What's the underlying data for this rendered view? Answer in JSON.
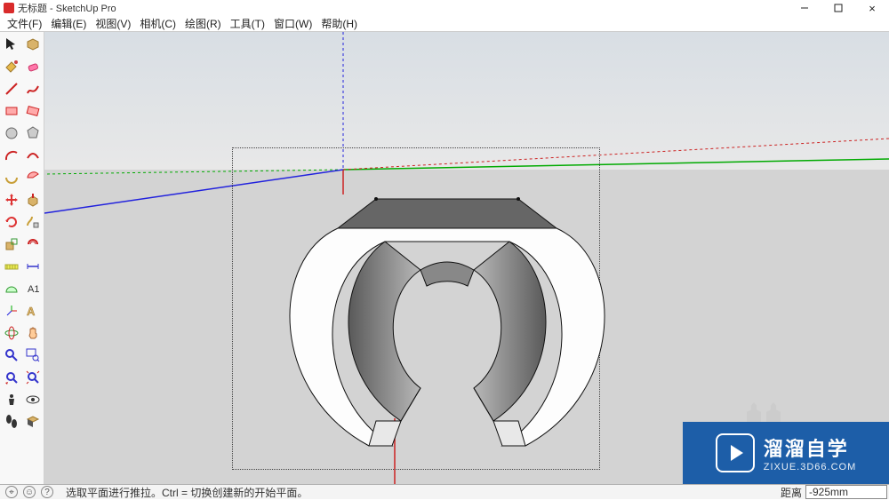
{
  "window": {
    "title": "无标题 - SketchUp Pro",
    "close": "×"
  },
  "menu": {
    "file": "文件(F)",
    "edit": "编辑(E)",
    "view": "视图(V)",
    "camera": "相机(C)",
    "draw": "绘图(R)",
    "tools": "工具(T)",
    "window": "窗口(W)",
    "help": "帮助(H)"
  },
  "status": {
    "hint": "选取平面进行推拉。Ctrl = 切换创建新的开始平面。",
    "dist_label": "距离",
    "dist_value": "-925mm",
    "btn_map": "⌖",
    "btn_user": "☺",
    "btn_help": "?"
  },
  "watermark": {
    "cn": "溜溜自学",
    "en": "ZIXUE.3D66.COM"
  },
  "colors": {
    "axis_red": "#d11",
    "axis_green": "#0a0",
    "axis_blue": "#22d",
    "brand_blue": "#1d5ea8"
  },
  "icons": {
    "select": "select-tool",
    "eraser": "eraser-tool",
    "line": "line-tool",
    "freehand": "freehand-tool",
    "rectangle": "rectangle-tool",
    "rotated-rect": "rotated-rectangle-tool",
    "circle": "circle-tool",
    "polygon": "polygon-tool",
    "arc": "arc-tool",
    "2pt-arc": "2pt-arc-tool",
    "3pt-arc": "3pt-arc-tool",
    "pie": "pie-tool",
    "move": "move-tool",
    "pushpull": "pushpull-tool",
    "rotate": "rotate-tool",
    "followme": "followme-tool",
    "scale": "scale-tool",
    "offset": "offset-tool",
    "tape": "tape-tool",
    "dimension": "dimension-tool",
    "protractor": "protractor-tool",
    "text": "text-tool",
    "axes": "axes-tool",
    "3dtext": "3d-text-tool",
    "orbit": "orbit-tool",
    "pan": "pan-tool",
    "zoom": "zoom-tool",
    "zoom-window": "zoom-window-tool",
    "prev-view": "prev-view-tool",
    "zoom-extents": "zoom-extents-tool",
    "position-camera": "position-camera-tool",
    "lookaround": "lookaround-tool",
    "walk": "walk-tool",
    "section": "section-tool"
  }
}
